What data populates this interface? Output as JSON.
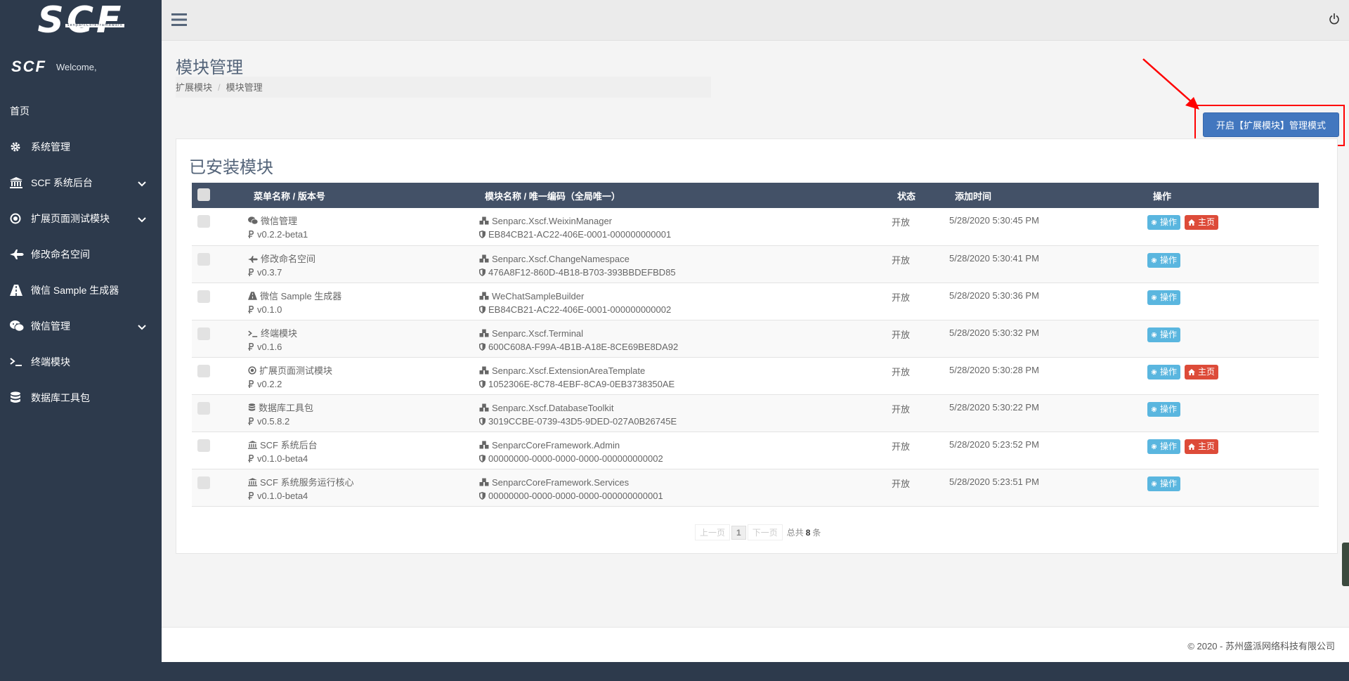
{
  "brand": {
    "logo_text": "SCF",
    "logo_subtitle": "SenparcCoreFramework",
    "user_logo_text": "SCF",
    "welcome": "Welcome,"
  },
  "sidebar": {
    "items": [
      {
        "label": "首页",
        "icon": "none",
        "expandable": false
      },
      {
        "label": "系统管理",
        "icon": "gear-icon",
        "expandable": false
      },
      {
        "label": "SCF 系统后台",
        "icon": "bank-icon",
        "expandable": true
      },
      {
        "label": "扩展页面测试模块",
        "icon": "dot-circle-icon",
        "expandable": true
      },
      {
        "label": "修改命名空间",
        "icon": "plane-icon",
        "expandable": false
      },
      {
        "label": "微信 Sample 生成器",
        "icon": "road-icon",
        "expandable": false
      },
      {
        "label": "微信管理",
        "icon": "wechat-icon",
        "expandable": true
      },
      {
        "label": "终端模块",
        "icon": "terminal-icon",
        "expandable": false
      },
      {
        "label": "数据库工具包",
        "icon": "database-icon",
        "expandable": false
      }
    ]
  },
  "page": {
    "title": "模块管理",
    "breadcrumb": [
      "扩展模块",
      "模块管理"
    ],
    "mode_button": "开启【扩展模块】管理模式"
  },
  "panel": {
    "title": "已安装模块",
    "columns": [
      "菜单名称 / 版本号",
      "模块名称 / 唯一编码（全局唯一）",
      "状态",
      "添加时间",
      "操作"
    ],
    "rows": [
      {
        "menu": "微信管理",
        "icon": "wechat-icon",
        "version": "v0.2.2-beta1",
        "module": "Senparc.Xscf.WeixinManager",
        "uid": "EB84CB21-AC22-406E-0001-000000000001",
        "status": "开放",
        "time": "5/28/2020 5:30:45 PM",
        "op": "操作",
        "home": "主页"
      },
      {
        "menu": "修改命名空间",
        "icon": "plane-icon",
        "version": "v0.3.7",
        "module": "Senparc.Xscf.ChangeNamespace",
        "uid": "476A8F12-860D-4B18-B703-393BBDEFBD85",
        "status": "开放",
        "time": "5/28/2020 5:30:41 PM",
        "op": "操作",
        "home": ""
      },
      {
        "menu": "微信 Sample 生成器",
        "icon": "road-icon",
        "version": "v0.1.0",
        "module": "WeChatSampleBuilder",
        "uid": "EB84CB21-AC22-406E-0001-000000000002",
        "status": "开放",
        "time": "5/28/2020 5:30:36 PM",
        "op": "操作",
        "home": ""
      },
      {
        "menu": "终端模块",
        "icon": "terminal-icon",
        "version": "v0.1.6",
        "module": "Senparc.Xscf.Terminal",
        "uid": "600C608A-F99A-4B1B-A18E-8CE69BE8DA92",
        "status": "开放",
        "time": "5/28/2020 5:30:32 PM",
        "op": "操作",
        "home": ""
      },
      {
        "menu": "扩展页面测试模块",
        "icon": "dot-circle-icon",
        "version": "v0.2.2",
        "module": "Senparc.Xscf.ExtensionAreaTemplate",
        "uid": "1052306E-8C78-4EBF-8CA9-0EB3738350AE",
        "status": "开放",
        "time": "5/28/2020 5:30:28 PM",
        "op": "操作",
        "home": "主页"
      },
      {
        "menu": "数据库工具包",
        "icon": "database-icon",
        "version": "v0.5.8.2",
        "module": "Senparc.Xscf.DatabaseToolkit",
        "uid": "3019CCBE-0739-43D5-9DED-027A0B26745E",
        "status": "开放",
        "time": "5/28/2020 5:30:22 PM",
        "op": "操作",
        "home": ""
      },
      {
        "menu": "SCF 系统后台",
        "icon": "bank-icon",
        "version": "v0.1.0-beta4",
        "module": "SenparcCoreFramework.Admin",
        "uid": "00000000-0000-0000-0000-000000000002",
        "status": "开放",
        "time": "5/28/2020 5:23:52 PM",
        "op": "操作",
        "home": "主页"
      },
      {
        "menu": "SCF 系统服务运行核心",
        "icon": "bank-icon",
        "version": "v0.1.0-beta4",
        "module": "SenparcCoreFramework.Services",
        "uid": "00000000-0000-0000-0000-000000000001",
        "status": "开放",
        "time": "5/28/2020 5:23:51 PM",
        "op": "操作",
        "home": ""
      }
    ]
  },
  "pagination": {
    "prev": "上一页",
    "current": "1",
    "next": "下一页",
    "total_prefix": "总共",
    "total_count": "8",
    "total_suffix": "条"
  },
  "footer": {
    "copyright": "© 2020 - 苏州盛派网络科技有限公司"
  },
  "colors": {
    "sidebar_bg": "#2d3a4c",
    "table_header_bg": "#435167",
    "primary_button": "#4277bf",
    "op_button": "#5ab6df",
    "home_button": "#dd4b39",
    "highlight_border": "#ff0000"
  }
}
